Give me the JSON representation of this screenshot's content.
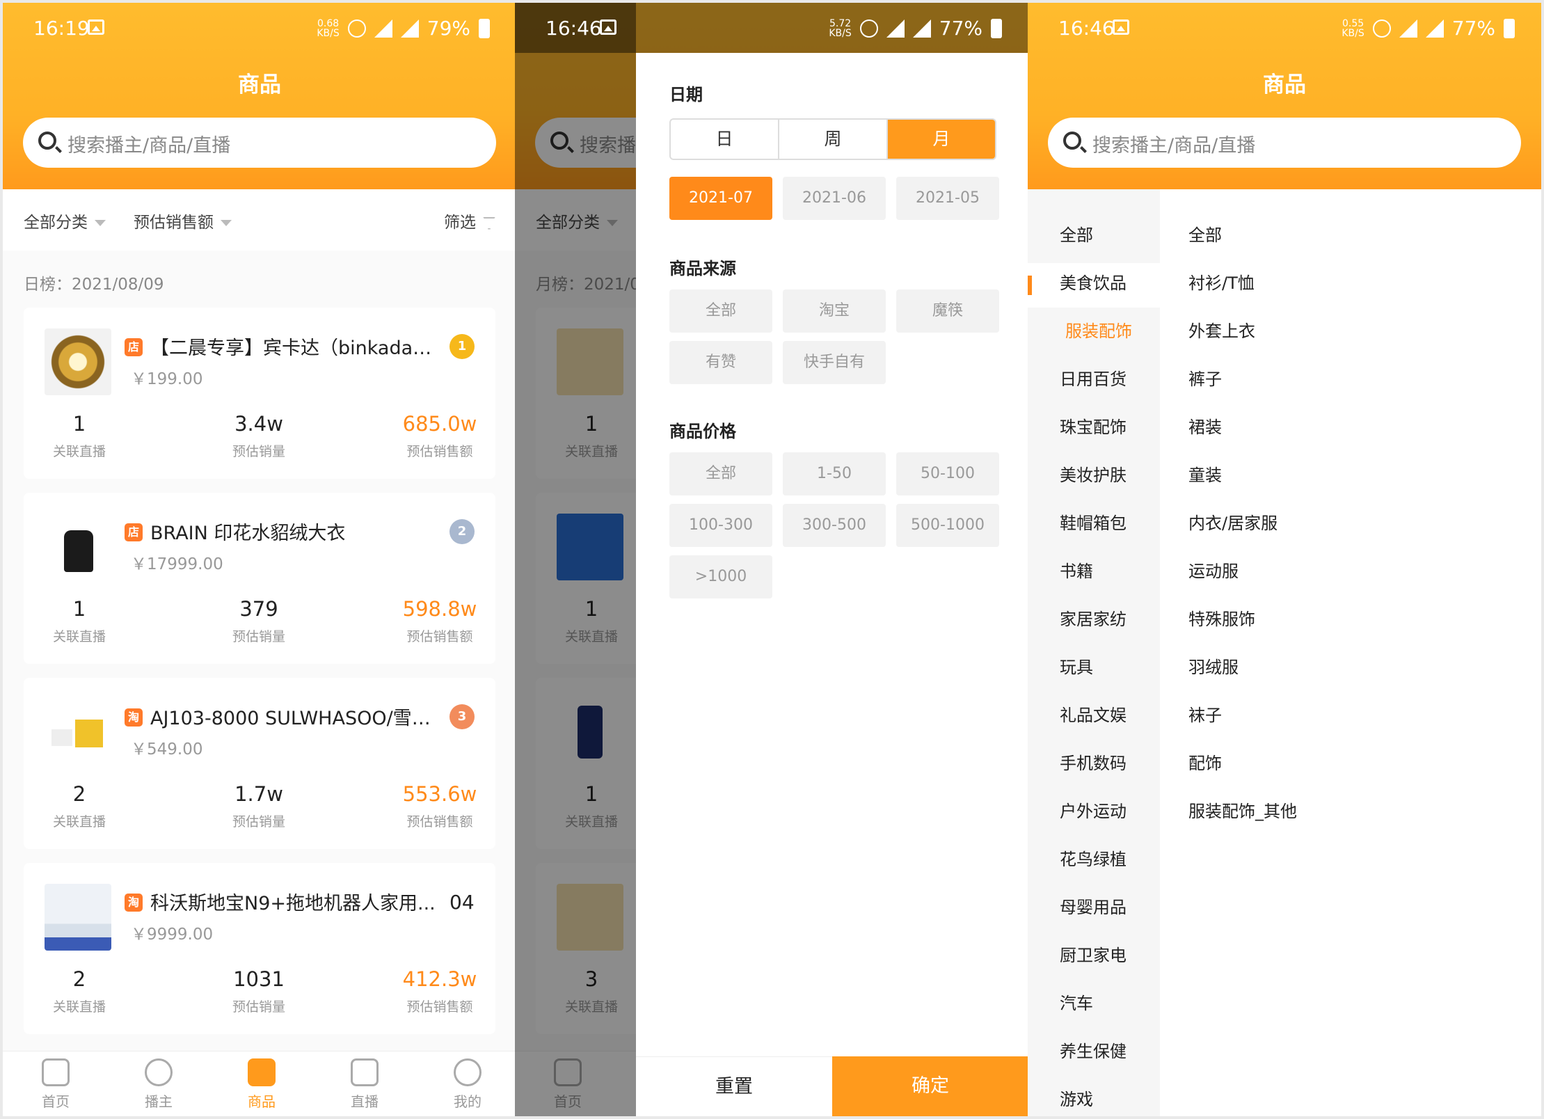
{
  "status_left": {
    "time": "16:19",
    "speed": "0.68\nKB/S",
    "battery": "79%"
  },
  "status_mid": {
    "time": "16:46",
    "speed": "5.72\nKB/S",
    "battery": "77%"
  },
  "status_right": {
    "time": "16:46",
    "speed": "0.55\nKB/S",
    "battery": "77%"
  },
  "page_title": "商品",
  "search_placeholder": "搜索播主/商品/直播",
  "search_placeholder_short": "搜索播",
  "filter": {
    "category": "全部分类",
    "sort": "预估销售额",
    "filter": "筛选"
  },
  "rank_date": "日榜：2021/08/09",
  "rank_date_month": "月榜：2021/0",
  "stat_labels": {
    "live": "关联直播",
    "sales": "预估销量",
    "revenue": "预估销售额"
  },
  "products": [
    {
      "name": "【二晨专享】宾卡达（binkada）...",
      "price": "￥199.00",
      "rank": "1",
      "source": "店",
      "live": "1",
      "sales": "3.4w",
      "revenue": "685.0w"
    },
    {
      "name": "BRAIN 印花水貂绒大衣",
      "price": "￥17999.00",
      "rank": "2",
      "source": "店",
      "live": "1",
      "sales": "379",
      "revenue": "598.8w"
    },
    {
      "name": "AJ103-8000 SULWHASOO/雪花...",
      "price": "￥549.00",
      "rank": "3",
      "source": "淘",
      "live": "2",
      "sales": "1.7w",
      "revenue": "553.6w"
    },
    {
      "name": "科沃斯地宝N9+拖地机器人家用...",
      "price": "￥9999.00",
      "rank": "04",
      "source": "淘",
      "live": "2",
      "sales": "1031",
      "revenue": "412.3w"
    }
  ],
  "dim_products": [
    {
      "live": "1"
    },
    {
      "live": "1"
    },
    {
      "live": "1"
    },
    {
      "live": "3"
    }
  ],
  "tabs": [
    {
      "label": "首页",
      "active": false
    },
    {
      "label": "播主",
      "active": false
    },
    {
      "label": "商品",
      "active": true
    },
    {
      "label": "直播",
      "active": false
    },
    {
      "label": "我的",
      "active": false
    }
  ],
  "drawer": {
    "date_title": "日期",
    "periods": [
      "日",
      "周",
      "月"
    ],
    "selected_period": "月",
    "months": [
      "2021-07",
      "2021-06",
      "2021-05"
    ],
    "selected_month": "2021-07",
    "source_title": "商品来源",
    "sources": [
      "全部",
      "淘宝",
      "魔筷",
      "有赞",
      "快手自有"
    ],
    "price_title": "商品价格",
    "prices": [
      "全部",
      "1-50",
      "50-100",
      "100-300",
      "300-500",
      "500-1000",
      ">1000"
    ],
    "reset": "重置",
    "confirm": "确定"
  },
  "categories": [
    "全部",
    "美食饮品",
    "服装配饰",
    "日用百货",
    "珠宝配饰",
    "美妆护肤",
    "鞋帽箱包",
    "书籍",
    "家居家纺",
    "玩具",
    "礼品文娱",
    "手机数码",
    "户外运动",
    "花鸟绿植",
    "母婴用品",
    "厨卫家电",
    "汽车",
    "养生保健",
    "游戏"
  ],
  "selected_category": "服装配饰",
  "subcategories": [
    "全部",
    "衬衫/T恤",
    "外套上衣",
    "裤子",
    "裙装",
    "童装",
    "内衣/居家服",
    "运动服",
    "特殊服饰",
    "羽绒服",
    "袜子",
    "配饰",
    "服装配饰_其他"
  ],
  "colors": {
    "accent": "#ff9a1c",
    "orange_text": "#ff8a1a",
    "header": "#ffb126"
  }
}
